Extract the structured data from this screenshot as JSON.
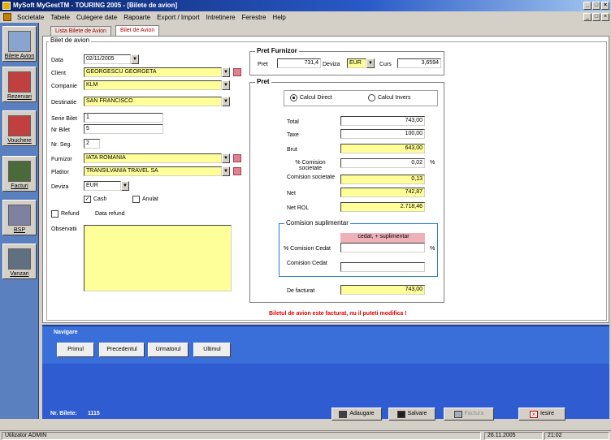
{
  "window": {
    "title": "MySoft MyGestTM - TOURING 2005 - [Bilete de avion]"
  },
  "menu": [
    "Societate",
    "Tabele",
    "Culegere date",
    "Rapoarte",
    "Export / Import",
    "Intretinere",
    "Ferestre",
    "Help"
  ],
  "sidebar": [
    {
      "label": "Bilete Avion",
      "icon": "airplane-icon",
      "color": "#8aa4d0"
    },
    {
      "label": "Rezervari",
      "icon": "reservation-book-icon",
      "color": "#c04040"
    },
    {
      "label": "Vouchere",
      "icon": "voucher-icon",
      "color": "#c04040"
    },
    {
      "label": "Facturi",
      "icon": "invoice-icon",
      "color": "#4a6a3a"
    },
    {
      "label": "BSP",
      "icon": "bsp-icon",
      "color": "#8080a0"
    },
    {
      "label": "Vanzari",
      "icon": "sales-icon",
      "color": "#607080"
    }
  ],
  "tabs": [
    "Lista Bilete de Avion",
    "Bilet de Avion"
  ],
  "bilet": {
    "group_title": "Bilet de avion",
    "data_label": "Data",
    "data_value": "02/11/2005",
    "client_label": "Client",
    "client_value": "GEORGESCU GEORGETA",
    "companie_label": "Companie",
    "companie_value": "KLM",
    "destinatie_label": "Destinatie",
    "destinatie_value": "SAN FRANCISCO",
    "serie_label": "Serie Bilet",
    "serie_value": "1",
    "nrbilet_label": "Nr Bilet",
    "nrbilet_value": "5",
    "nrseg_label": "Nr. Seg.",
    "nrseg_value": "2",
    "furnizor_label": "Furnizor",
    "furnizor_value": "IATA ROMANIA",
    "platitor_label": "Platitor",
    "platitor_value": "TRANSILVANIA TRAVEL SA",
    "deviza_label": "Deviza",
    "deviza_value": "EUR",
    "cash_label": "Cash",
    "anulat_label": "Anulat",
    "refund_label": "Refund",
    "datarefund_label": "Data refund",
    "observatii_label": "Observatii"
  },
  "pret_furnizor": {
    "group_title": "Pret Furnizor",
    "pret_label": "Pret",
    "pret_value": "731,4",
    "deviza_label": "Deviza",
    "deviza_value": "EUR",
    "curs_label": "Curs",
    "curs_value": "3,6594"
  },
  "pret": {
    "group_title": "Pret",
    "calcul_direct": "Calcul Direct",
    "calcul_invers": "Calcul Invers",
    "total_label": "Total",
    "total_value": "743,00",
    "taxe_label": "Taxe",
    "taxe_value": "100,00",
    "brut_label": "Brut",
    "brut_value": "643,00",
    "comision_pct_label": "% Comision societate",
    "comision_pct_value": "0,02",
    "pct_sign": "%",
    "comision_label": "Comision societate",
    "comision_value": "0,13",
    "net_label": "Net",
    "net_value": "742,87",
    "netrol_label": "Net ROL",
    "netrol_value": "2.718,46",
    "suplim_title": "Comision suplimentar",
    "suplim_header": "cedat, + suplimentar",
    "comision_cedat_pct_label": "% Comision Cedat",
    "comision_cedat_label": "Comision Cedat",
    "defacturat_label": "De facturat",
    "defacturat_value": "743,00",
    "warning": "Biletul de avion este facturat, nu il puteti modifica !"
  },
  "navigare": {
    "title": "Navigare",
    "buttons": [
      "Primul",
      "Precedentul",
      "Urmatorul",
      "Ultimul"
    ]
  },
  "footer": {
    "nr_bilete_label": "Nr. Bilete:",
    "nr_bilete_value": "1115",
    "actions": [
      {
        "label": "Adaugare",
        "icon": "add-record-icon"
      },
      {
        "label": "Salvare",
        "icon": "save-disk-icon"
      },
      {
        "label": "Factura",
        "icon": "invoice-print-icon"
      },
      {
        "label": "Iesire",
        "icon": "exit-x-icon"
      }
    ]
  },
  "statusbar": {
    "user": "Utilizator ADMIN",
    "date": "26.11.2005",
    "time": "21:02"
  }
}
